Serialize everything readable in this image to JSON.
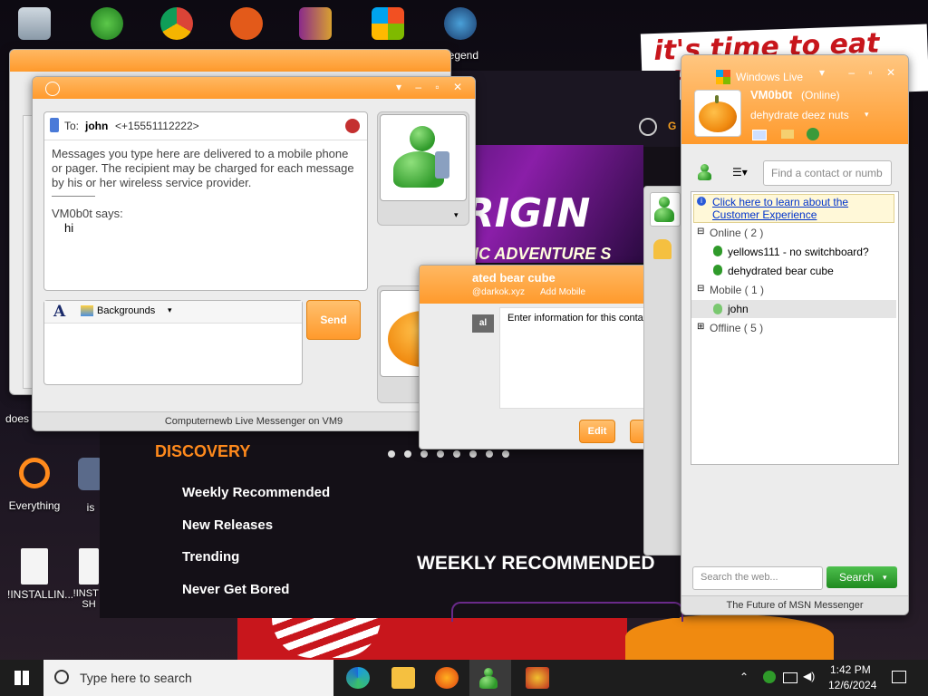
{
  "desktop": {
    "wallpaper_text": "it's time to eat shit",
    "icons": [
      {
        "label": "",
        "icon": "recycle-bin-icon"
      },
      {
        "label": "",
        "icon": "messenger-shortcut-icon"
      },
      {
        "label": "",
        "icon": "chrome-icon"
      },
      {
        "label": "",
        "icon": "p-shortcut-icon"
      },
      {
        "label": "",
        "icon": "winrar-icon"
      },
      {
        "label": "",
        "icon": "windows-shortcut-icon"
      },
      {
        "label": "Legend",
        "icon": "game-shortcut-icon"
      },
      {
        "label": "Everything",
        "icon": "everything-search-icon"
      },
      {
        "label": "is",
        "icon": "shortcut-icon"
      },
      {
        "label": "!INSTALLIN...",
        "icon": "text-file-icon"
      },
      {
        "label": "!INST -SH",
        "icon": "text-file-icon"
      },
      {
        "label": "does",
        "icon": "partial-icon"
      }
    ]
  },
  "store": {
    "banner_title": "K ORIGIN",
    "banner_subtitle": "RIC ADVENTURE S",
    "discovery_heading": "DISCOVERY",
    "nav": [
      "Weekly Recommended",
      "New Releases",
      "Trending",
      "Never Get Bored"
    ],
    "section_title": "WEEKLY RECOMMENDED",
    "top_partial": "G"
  },
  "chat": {
    "to_label": "To:",
    "contact_name": "john",
    "contact_number": "<+15551112222>",
    "notice": "Messages you type here are delivered to a mobile phone or pager. The recipient may be charged for each message by his or her wireless service provider.",
    "sender_line": "VM0b0t says:",
    "message": "hi",
    "font_icon_label": "A",
    "backgrounds_label": "Backgrounds",
    "send_label": "Send",
    "footer": "Computernewb Live Messenger on VM9"
  },
  "contact_card": {
    "name": "ated bear cube",
    "email": "@darkok.xyz",
    "add_mobile": "Add Mobile",
    "tab_partial": "al",
    "info_text": "Enter information for this contact",
    "edit_label": "Edit"
  },
  "main_window": {
    "logo_text": "Windows Live",
    "username": "VM0b0t",
    "status": "(Online)",
    "personal_message": "dehydrate deez nuts",
    "search_placeholder": "Find a contact or numb",
    "info_bar": "Click here to learn about the Customer Experience",
    "groups": [
      {
        "label": "Online ( 2 )",
        "expanded": true,
        "contacts": [
          "yellows111 - no switchboard?",
          "dehydrated bear cube"
        ]
      },
      {
        "label": "Mobile ( 1 )",
        "expanded": true,
        "contacts": [
          "john"
        ]
      },
      {
        "label": "Offline ( 5 )",
        "expanded": false,
        "contacts": []
      }
    ],
    "web_search_placeholder": "Search the web...",
    "search_button": "Search",
    "footer": "The Future of MSN Messenger"
  },
  "taskbar": {
    "search_placeholder": "Type here to search",
    "time": "1:42 PM",
    "date": "12/6/2024"
  },
  "colors": {
    "accent_orange": "#ff9a2c",
    "msn_green": "#2f9a2a",
    "link_blue": "#0033cc"
  }
}
